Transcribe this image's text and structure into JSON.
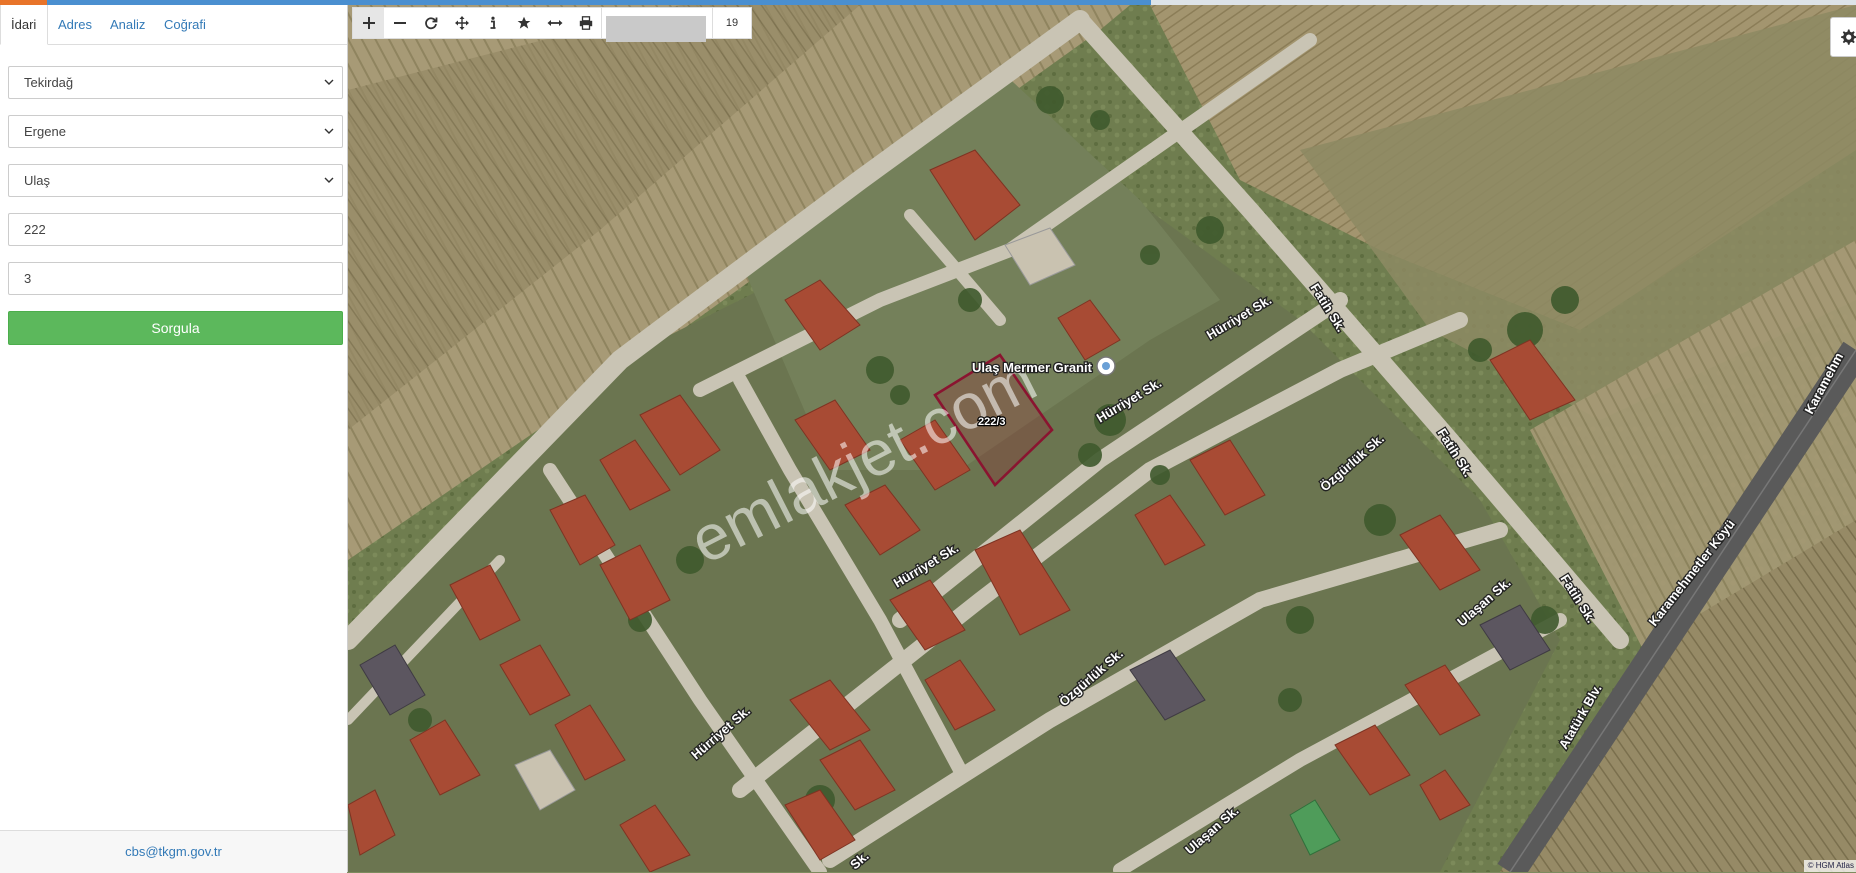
{
  "tabs": [
    "İdari",
    "Adres",
    "Analiz",
    "Coğrafi"
  ],
  "form": {
    "il": "Tekirdağ",
    "ilce": "Ergene",
    "mahalle": "Ulaş",
    "ada": "222",
    "parsel": "3",
    "submit": "Sorgula"
  },
  "footer_email": "cbs@tkgm.gov.tr",
  "toolbar": {
    "tools": [
      "zoom-in",
      "zoom-out",
      "refresh",
      "move",
      "info",
      "bookmark",
      "measure",
      "print"
    ],
    "zoom_level": "19"
  },
  "map": {
    "parcel_label": "222/3",
    "poi_label": "Ulaş Mermer Granit",
    "watermark": "emlakjet.com",
    "attribution": "© HGM Atlas",
    "streets": {
      "hurriyet_1": "Hürriyet Sk.",
      "hurriyet_2": "Hürriyet Sk.",
      "hurriyet_3": "Hürriyet Sk.",
      "hurriyet_4": "Hürriyet Sk.",
      "fatih_1": "Fatih Sk.",
      "fatih_2": "Fatih Sk.",
      "fatih_3": "Fatih Sk.",
      "ozgurluk_1": "Özgürlük Sk.",
      "ozgurluk_2": "Özgürlük Sk.",
      "ulasan_1": "Ulaşan Sk.",
      "ulasan_2": "Ulaşan Sk.",
      "karamehmetler": "Karamehmetler Köyü",
      "ataturk": "Atatürk Blv.",
      "karamehm_cut": "Karamehm",
      "sk_cut": "Sk."
    }
  }
}
